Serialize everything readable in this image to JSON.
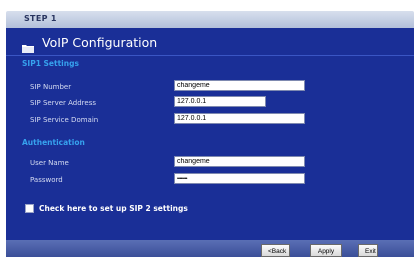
{
  "step": {
    "label": "STEP 1"
  },
  "header": {
    "title": "VoIP Configuration",
    "icon": "folder-icon"
  },
  "sip1": {
    "heading": "SIP1  Settings",
    "number_label": "SIP Number",
    "number_value": "changeme",
    "server_label": "SIP Server Address",
    "server_value": "127.0.0.1",
    "domain_label": "SIP Service Domain",
    "domain_value": "127.0.0.1"
  },
  "auth": {
    "heading": "Authentication",
    "username_label": "User Name",
    "username_value": "changeme",
    "password_label": "Password",
    "password_value": "••••••••"
  },
  "sip2": {
    "checkbox_label": "Check here to set up SIP 2  settings",
    "checked": false
  },
  "buttons": {
    "back": "<Back",
    "apply": "Apply",
    "exit": "Exit"
  },
  "colors": {
    "panel": "#1a2f97",
    "section_heading": "#36a2ee",
    "step_bar": "#c4cee3"
  }
}
